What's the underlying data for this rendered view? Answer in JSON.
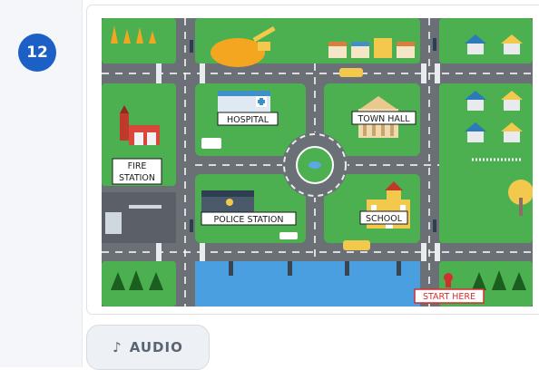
{
  "question": {
    "number": "12"
  },
  "map": {
    "labels": {
      "hospital": "HOSPITAL",
      "town_hall": "TOWN HALL",
      "fire_line1": "FIRE",
      "fire_line2": "STATION",
      "police": "POLICE STATION",
      "school": "SCHOOL",
      "start": "START HERE"
    }
  },
  "audio": {
    "icon": "music-note-icon",
    "label": "AUDIO"
  },
  "colors": {
    "badge": "#1c5fc7",
    "grass": "#4caf50",
    "road": "#6b7077",
    "water": "#4a9fe0",
    "start": "#d32f2f"
  }
}
